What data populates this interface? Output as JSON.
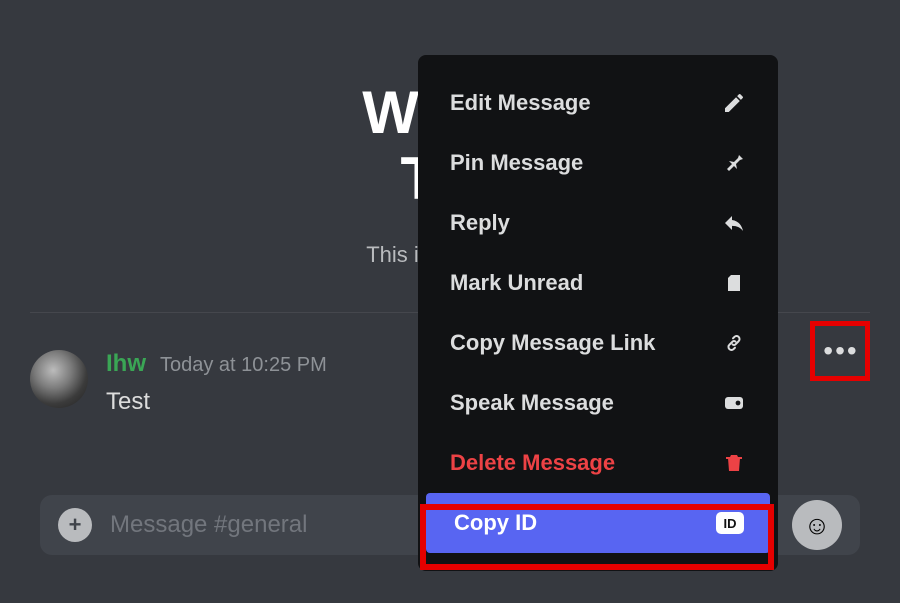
{
  "welcome": {
    "title_line1": "Welco",
    "title_line2": "Tes",
    "subtitle": "This is the beginr"
  },
  "message": {
    "username": "Ihw",
    "timestamp": "Today at 10:25 PM",
    "content": "Test"
  },
  "input": {
    "placeholder": "Message #general"
  },
  "context_menu": {
    "items": [
      {
        "label": "Edit Message",
        "icon": "pencil"
      },
      {
        "label": "Pin Message",
        "icon": "pin"
      },
      {
        "label": "Reply",
        "icon": "reply"
      },
      {
        "label": "Mark Unread",
        "icon": "mark"
      },
      {
        "label": "Copy Message Link",
        "icon": "link"
      },
      {
        "label": "Speak Message",
        "icon": "speak"
      },
      {
        "label": "Delete Message",
        "icon": "trash",
        "danger": true
      },
      {
        "label": "Copy ID",
        "icon": "id",
        "selected": true
      }
    ]
  }
}
